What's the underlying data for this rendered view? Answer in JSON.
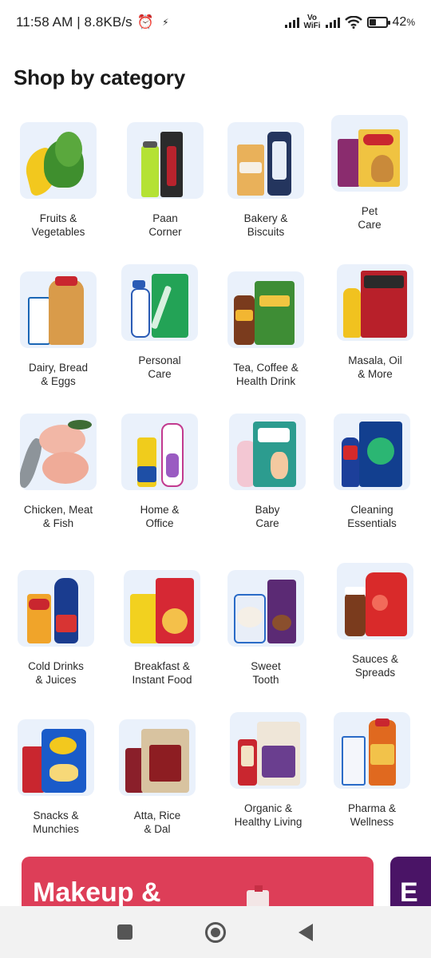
{
  "status_bar": {
    "time": "11:58 AM",
    "speed": "8.8KB/s",
    "network_label_top": "Vo",
    "network_label_bottom": "WiFi",
    "battery_percent": "42",
    "battery_percent_suffix": "%",
    "battery_level": 0.42
  },
  "section": {
    "title": "Shop by category"
  },
  "categories": [
    {
      "line1": "Fruits &",
      "line2": "Vegetables",
      "icon": "fruits-vegetables-image"
    },
    {
      "line1": "Paan",
      "line2": "Corner",
      "icon": "paan-corner-image"
    },
    {
      "line1": "Bakery &",
      "line2": "Biscuits",
      "icon": "bakery-biscuits-image"
    },
    {
      "line1": "Pet",
      "line2": "Care",
      "icon": "pet-care-image"
    },
    {
      "line1": "Dairy, Bread",
      "line2": "& Eggs",
      "icon": "dairy-bread-eggs-image"
    },
    {
      "line1": "Personal",
      "line2": "Care",
      "icon": "personal-care-image"
    },
    {
      "line1": "Tea, Coffee &",
      "line2": "Health Drink",
      "icon": "tea-coffee-image"
    },
    {
      "line1": "Masala, Oil",
      "line2": "& More",
      "icon": "masala-oil-image"
    },
    {
      "line1": "Chicken, Meat",
      "line2": "& Fish",
      "icon": "chicken-meat-fish-image"
    },
    {
      "line1": "Home &",
      "line2": "Office",
      "icon": "home-office-image"
    },
    {
      "line1": "Baby",
      "line2": "Care",
      "icon": "baby-care-image"
    },
    {
      "line1": "Cleaning",
      "line2": "Essentials",
      "icon": "cleaning-essentials-image"
    },
    {
      "line1": "Cold Drinks",
      "line2": "& Juices",
      "icon": "cold-drinks-image"
    },
    {
      "line1": "Breakfast &",
      "line2": "Instant Food",
      "icon": "breakfast-instant-image"
    },
    {
      "line1": "Sweet",
      "line2": "Tooth",
      "icon": "sweet-tooth-image"
    },
    {
      "line1": "Sauces &",
      "line2": "Spreads",
      "icon": "sauces-spreads-image"
    },
    {
      "line1": "Snacks &",
      "line2": "Munchies",
      "icon": "snacks-munchies-image"
    },
    {
      "line1": "Atta, Rice",
      "line2": "& Dal",
      "icon": "atta-rice-dal-image"
    },
    {
      "line1": "Organic &",
      "line2": "Healthy Living",
      "icon": "organic-healthy-image"
    },
    {
      "line1": "Pharma &",
      "line2": "Wellness",
      "icon": "pharma-wellness-image"
    }
  ],
  "banners": [
    {
      "title": "Makeup &"
    },
    {
      "title": "E"
    }
  ],
  "nav": {
    "recent_icon": "square-icon",
    "home_icon": "circle-home-icon",
    "back_icon": "triangle-back-icon"
  },
  "colors": {
    "tile_background": "#eaf1fb",
    "banner_primary": "#dd3e58",
    "banner_secondary": "#4a1466"
  }
}
